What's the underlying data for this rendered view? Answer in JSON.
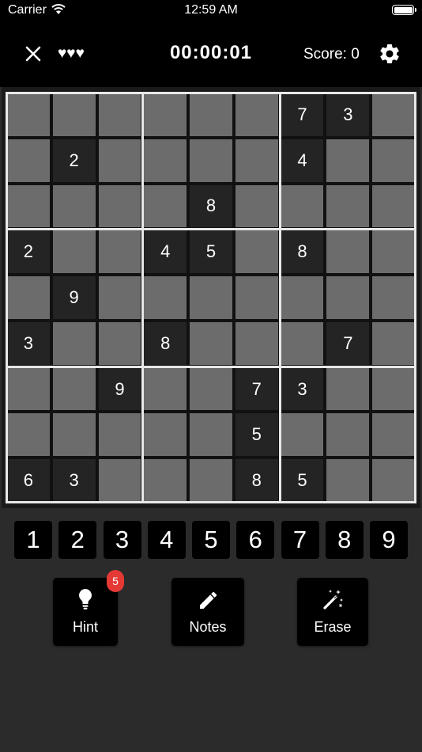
{
  "status_bar": {
    "carrier": "Carrier",
    "time": "12:59 AM"
  },
  "header": {
    "lives": "♥♥♥",
    "timer": "00:00:01",
    "score": "Score: 0"
  },
  "board": [
    [
      "",
      "",
      "",
      "",
      "",
      "",
      "7",
      "3",
      ""
    ],
    [
      "",
      "2",
      "",
      "",
      "",
      "",
      "4",
      "",
      ""
    ],
    [
      "",
      "",
      "",
      "",
      "8",
      "",
      "",
      "",
      ""
    ],
    [
      "2",
      "",
      "",
      "4",
      "5",
      "",
      "8",
      "",
      ""
    ],
    [
      "",
      "9",
      "",
      "",
      "",
      "",
      "",
      "",
      ""
    ],
    [
      "3",
      "",
      "",
      "8",
      "",
      "",
      "",
      "7",
      ""
    ],
    [
      "",
      "",
      "9",
      "",
      "",
      "7",
      "3",
      "",
      ""
    ],
    [
      "",
      "",
      "",
      "",
      "",
      "5",
      "",
      "",
      ""
    ],
    [
      "6",
      "3",
      "",
      "",
      "",
      "8",
      "5",
      "",
      ""
    ]
  ],
  "numpad": [
    "1",
    "2",
    "3",
    "4",
    "5",
    "6",
    "7",
    "8",
    "9"
  ],
  "actions": {
    "hint": {
      "label": "Hint",
      "badge": "5"
    },
    "notes": {
      "label": "Notes"
    },
    "erase": {
      "label": "Erase"
    }
  },
  "colors": {
    "background": "#2b2b2b",
    "empty_cell": "#6c6c6c",
    "given_cell": "#242424",
    "box_border": "#e8e8e8",
    "badge": "#e53935"
  },
  "icons": {
    "close": "close-icon",
    "settings": "gear-icon",
    "hint": "lightbulb-icon",
    "notes": "pencil-icon",
    "erase": "magic-wand-icon"
  }
}
